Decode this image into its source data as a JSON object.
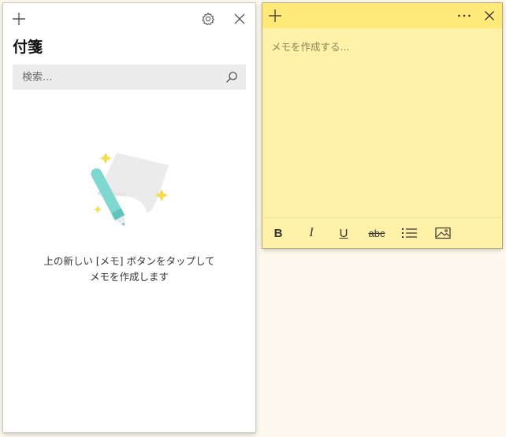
{
  "list_window": {
    "title": "付箋",
    "search": {
      "placeholder": "検索...",
      "value": ""
    },
    "empty_state": {
      "line1": "上の新しい [メモ] ボタンをタップして",
      "line2": "メモを作成します"
    },
    "icons": {
      "new_note": "plus-icon",
      "settings": "gear-icon",
      "close": "close-icon",
      "search": "search-icon"
    }
  },
  "note_window": {
    "placeholder": "メモを作成する...",
    "value": "",
    "toolbar": {
      "bold": "B",
      "italic": "I",
      "underline": "U",
      "strikethrough": "abc"
    },
    "icons": {
      "new_note": "plus-icon",
      "menu": "more-icon",
      "close": "close-icon",
      "bullets": "bullet-list-icon",
      "image": "image-icon"
    }
  },
  "colors": {
    "note_body": "#fff1a8",
    "note_header": "#ffe978",
    "search_bg": "#ececec",
    "desktop_bg": "#fdf9ee",
    "illustration_accent": "#7fd8d0",
    "sparkle": "#f7dc4a"
  }
}
